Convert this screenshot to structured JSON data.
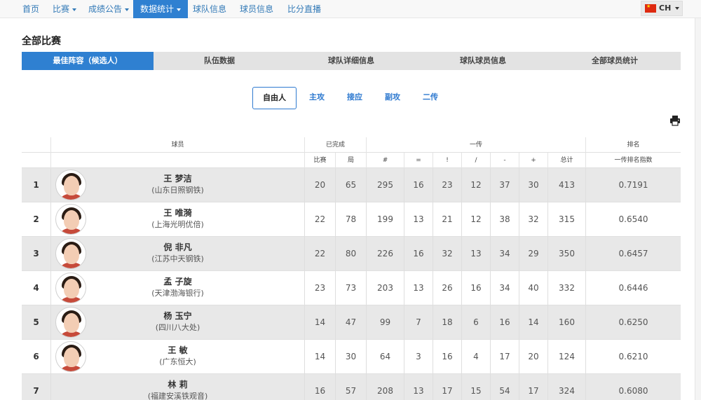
{
  "nav": {
    "items": [
      {
        "label": "首页",
        "dropdown": false
      },
      {
        "label": "比赛",
        "dropdown": true
      },
      {
        "label": "成绩公告",
        "dropdown": true
      },
      {
        "label": "数据统计",
        "dropdown": true,
        "active": true
      },
      {
        "label": "球队信息",
        "dropdown": false
      },
      {
        "label": "球员信息",
        "dropdown": false
      },
      {
        "label": "比分直播",
        "dropdown": false
      }
    ],
    "language": "CH"
  },
  "page_title": "全部比赛",
  "main_tabs": [
    "最佳阵容（候选人）",
    "队伍数据",
    "球队详细信息",
    "球队球员信息",
    "全部球员统计"
  ],
  "position_tabs": [
    "自由人",
    "主攻",
    "接应",
    "副攻",
    "二传"
  ],
  "table": {
    "group_headers": {
      "player": "球员",
      "completed": "已完成",
      "reception": "一传",
      "ranking": "排名"
    },
    "sub_headers": {
      "matches": "比赛",
      "sets": "局",
      "perfect": "#",
      "good": "=",
      "exclaim": "!",
      "slash": "/",
      "minus": "-",
      "plus": "+",
      "total": "总计",
      "index": "一传排名指数"
    },
    "rows": [
      {
        "rank": "1",
        "name": "王 梦洁",
        "team": "(山东日照钢铁)",
        "matches": "20",
        "sets": "65",
        "perfect": "295",
        "good": "16",
        "exclaim": "23",
        "slash": "12",
        "minus": "37",
        "plus": "30",
        "total": "413",
        "index": "0.7191",
        "avatar": true
      },
      {
        "rank": "2",
        "name": "王 唯漪",
        "team": "(上海光明优倍)",
        "matches": "22",
        "sets": "78",
        "perfect": "199",
        "good": "13",
        "exclaim": "21",
        "slash": "12",
        "minus": "38",
        "plus": "32",
        "total": "315",
        "index": "0.6540",
        "avatar": true
      },
      {
        "rank": "3",
        "name": "倪 非凡",
        "team": "(江苏中天钢铁)",
        "matches": "22",
        "sets": "80",
        "perfect": "226",
        "good": "16",
        "exclaim": "32",
        "slash": "13",
        "minus": "34",
        "plus": "29",
        "total": "350",
        "index": "0.6457",
        "avatar": true
      },
      {
        "rank": "4",
        "name": "孟 子旋",
        "team": "(天津渤海银行)",
        "matches": "23",
        "sets": "73",
        "perfect": "203",
        "good": "13",
        "exclaim": "26",
        "slash": "16",
        "minus": "34",
        "plus": "40",
        "total": "332",
        "index": "0.6446",
        "avatar": true
      },
      {
        "rank": "5",
        "name": "杨 玉宁",
        "team": "(四川八大处)",
        "matches": "14",
        "sets": "47",
        "perfect": "99",
        "good": "7",
        "exclaim": "18",
        "slash": "6",
        "minus": "16",
        "plus": "14",
        "total": "160",
        "index": "0.6250",
        "avatar": true
      },
      {
        "rank": "6",
        "name": "王 敏",
        "team": "(广东恒大)",
        "matches": "14",
        "sets": "30",
        "perfect": "64",
        "good": "3",
        "exclaim": "16",
        "slash": "4",
        "minus": "17",
        "plus": "20",
        "total": "124",
        "index": "0.6210",
        "avatar": true
      },
      {
        "rank": "7",
        "name": "林 莉",
        "team": "(福建安溪铁观音)",
        "matches": "16",
        "sets": "57",
        "perfect": "208",
        "good": "13",
        "exclaim": "17",
        "slash": "15",
        "minus": "54",
        "plus": "17",
        "total": "324",
        "index": "0.6080",
        "avatar": false
      }
    ]
  }
}
